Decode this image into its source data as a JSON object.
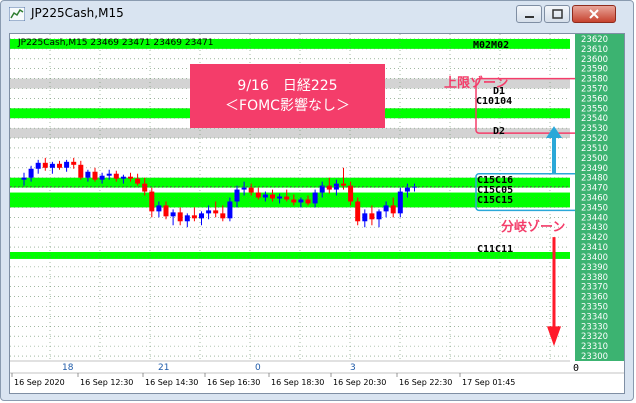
{
  "window": {
    "title": "JP225Cash,M15"
  },
  "chart": {
    "header": "JP225Cash,M15  23469 23471 23469 23471",
    "symbol": "JP225Cash",
    "timeframe": "M15",
    "ohlc": [
      23469,
      23471,
      23469,
      23471
    ],
    "price_labels": [
      "23620",
      "23610",
      "23600",
      "23590",
      "23580",
      "23570",
      "23560",
      "23550",
      "23540",
      "23530",
      "23520",
      "23510",
      "23500",
      "23490",
      "23480",
      "23470",
      "23460",
      "23450",
      "23440",
      "23430",
      "23420",
      "23410",
      "23400",
      "23390",
      "23380",
      "23370",
      "23360",
      "23350",
      "23340",
      "23330",
      "23320",
      "23310",
      "23300"
    ],
    "time_labels": [
      "16 Sep 2020",
      "16 Sep 12:30",
      "16 Sep 14:30",
      "16 Sep 16:30",
      "16 Sep 18:30",
      "16 Sep 20:30",
      "16 Sep 22:30",
      "17 Sep 01:45"
    ],
    "sub_labels": [
      "18",
      "21",
      "0",
      "3"
    ],
    "level_labels": {
      "top": "M02M02",
      "d1": "D1",
      "d1b": "C10104",
      "d2": "D2",
      "m1": "C15C16",
      "m2": "C15C05",
      "m3": "C15C15",
      "low": "C11C11",
      "extra": "0"
    },
    "colors": {
      "bull": "#0000ff",
      "bear": "#ff0000",
      "band": "#00ff00",
      "gray_band": "#d3d3d3",
      "axis_bg": "#3cb371",
      "upper_zone": "#f43d6a",
      "branch_zone": "#2aa8d8"
    }
  },
  "annotation": {
    "line1": "9/16　日経225",
    "line2": "＜FOMC影響なし＞"
  },
  "zones": {
    "upper": "上限ゾーン",
    "branch": "分岐ゾーン"
  }
}
